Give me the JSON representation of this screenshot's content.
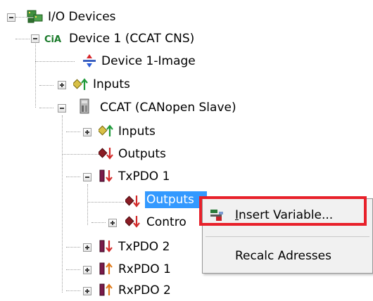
{
  "tree": {
    "root_label": "I/O Devices",
    "device_label": "Device 1 (CCAT CNS)",
    "device_image_label": "Device 1-Image",
    "device_inputs_label": "Inputs",
    "slave_label": "CCAT (CANopen Slave)",
    "slave_inputs_label": "Inputs",
    "slave_outputs_label": "Outputs",
    "txpdo1_label": "TxPDO 1",
    "txpdo1_outputs_label": "Outputs",
    "txpdo1_control_label": "Contro",
    "txpdo2_label": "TxPDO 2",
    "rxpdo1_label": "RxPDO 1",
    "rxpdo2_label": "RxPDO 2"
  },
  "context_menu": {
    "insert_variable_accel": "I",
    "insert_variable_rest": "nsert Variable...",
    "recalc_label": "Recalc Adresses"
  },
  "colors": {
    "selection": "#3399ff",
    "highlight_border": "#e8202a"
  }
}
